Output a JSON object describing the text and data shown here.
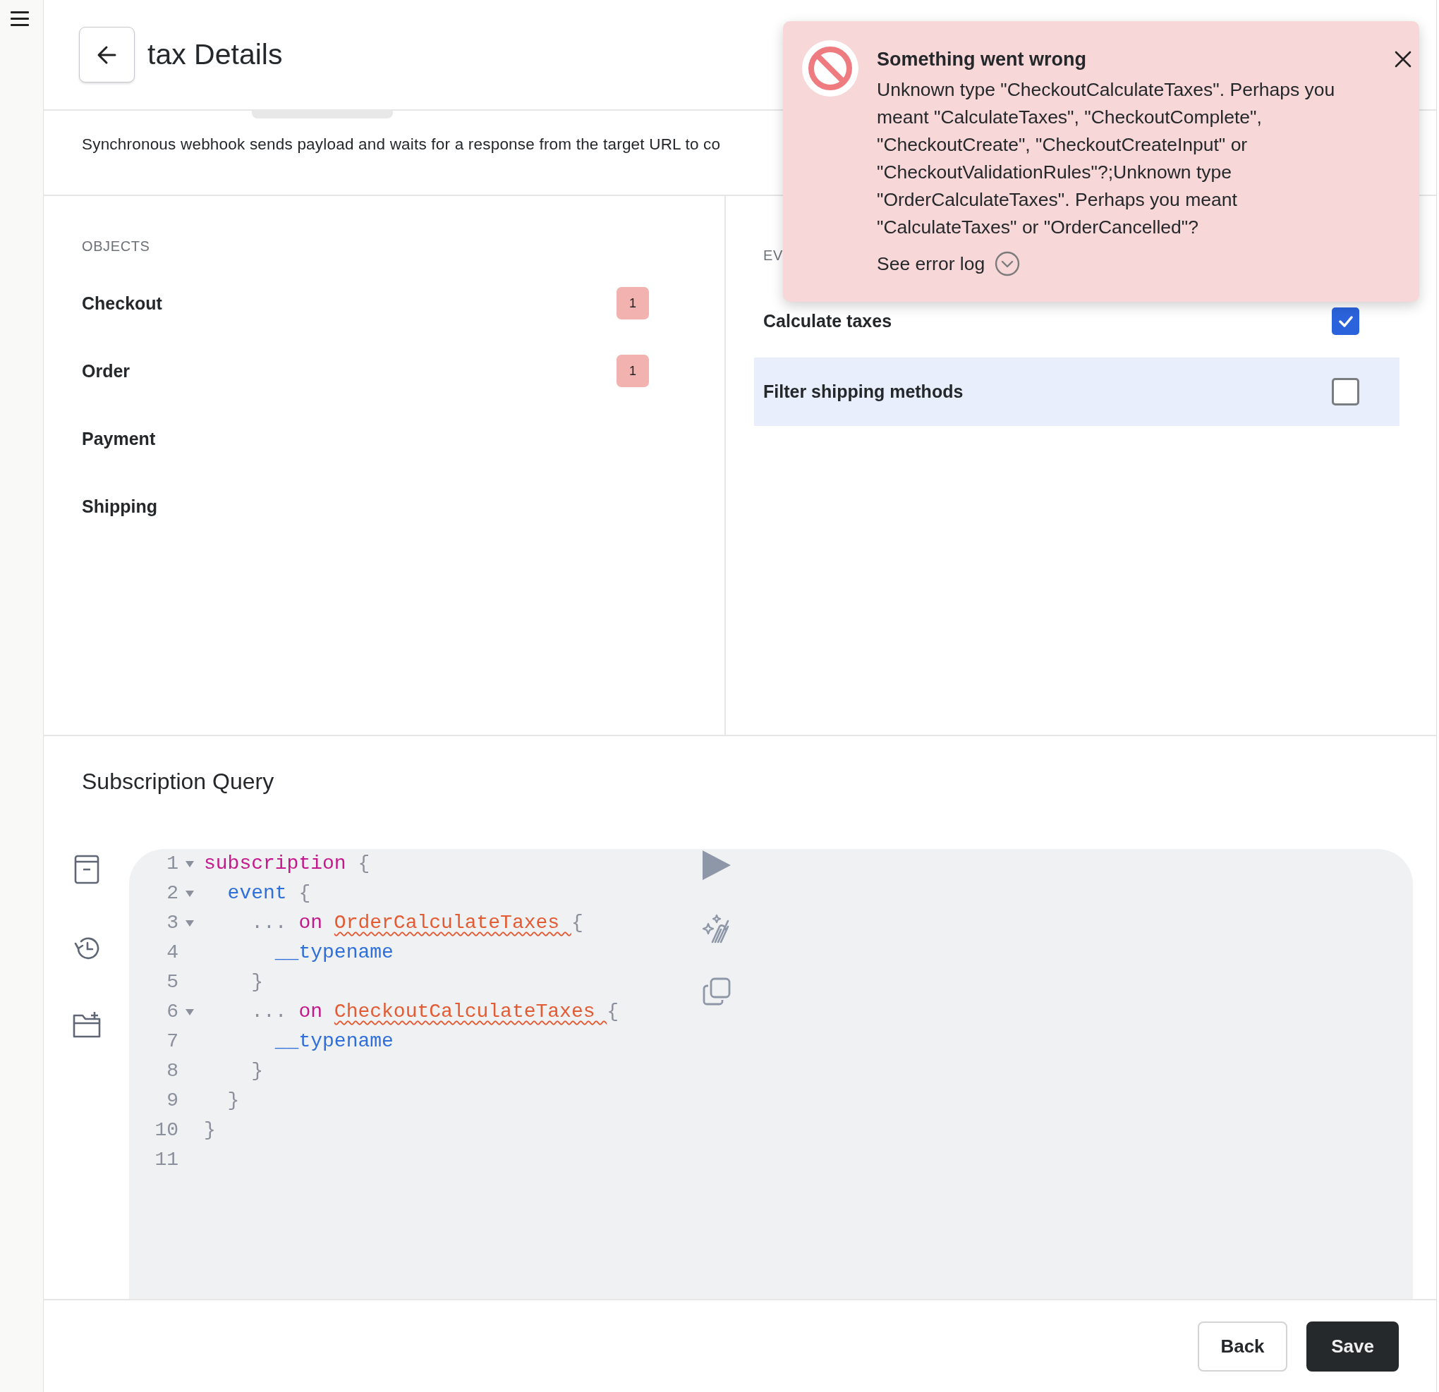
{
  "header": {
    "title": "tax Details"
  },
  "description": "Synchronous webhook sends payload and waits for a response from the target URL to co",
  "objects": {
    "heading": "OBJECTS",
    "items": [
      {
        "name": "Checkout",
        "badge": "1"
      },
      {
        "name": "Order",
        "badge": "1"
      },
      {
        "name": "Payment"
      },
      {
        "name": "Shipping"
      }
    ]
  },
  "events": {
    "heading": "EV",
    "items": [
      {
        "name": "Calculate taxes",
        "checked": true,
        "selected": false
      },
      {
        "name": "Filter shipping methods",
        "checked": false,
        "selected": true
      }
    ]
  },
  "query": {
    "title": "Subscription Query",
    "lines": [
      {
        "number": "1",
        "foldable": true,
        "tokens": [
          {
            "text": "subscription",
            "kind": "keyword"
          },
          {
            "text": " {",
            "kind": "punct"
          }
        ]
      },
      {
        "number": "2",
        "foldable": true,
        "tokens": [
          {
            "text": "  event",
            "kind": "field"
          },
          {
            "text": " {",
            "kind": "punct"
          }
        ]
      },
      {
        "number": "3",
        "foldable": true,
        "tokens": [
          {
            "text": "    ... ",
            "kind": "punct"
          },
          {
            "text": "on ",
            "kind": "keyword"
          },
          {
            "text": "OrderCalculateTaxes ",
            "kind": "error"
          },
          {
            "text": "{",
            "kind": "punct"
          }
        ]
      },
      {
        "number": "4",
        "foldable": false,
        "tokens": [
          {
            "text": "      __typename",
            "kind": "field"
          }
        ]
      },
      {
        "number": "5",
        "foldable": false,
        "tokens": [
          {
            "text": "    }",
            "kind": "punct"
          }
        ]
      },
      {
        "number": "6",
        "foldable": true,
        "tokens": [
          {
            "text": "    ... ",
            "kind": "punct"
          },
          {
            "text": "on ",
            "kind": "keyword"
          },
          {
            "text": "CheckoutCalculateTaxes ",
            "kind": "error"
          },
          {
            "text": "{",
            "kind": "punct"
          }
        ]
      },
      {
        "number": "7",
        "foldable": false,
        "tokens": [
          {
            "text": "      __typename",
            "kind": "field"
          }
        ]
      },
      {
        "number": "8",
        "foldable": false,
        "tokens": [
          {
            "text": "    }",
            "kind": "punct"
          }
        ]
      },
      {
        "number": "9",
        "foldable": false,
        "tokens": [
          {
            "text": "  }",
            "kind": "punct"
          }
        ]
      },
      {
        "number": "10",
        "foldable": false,
        "tokens": [
          {
            "text": "}",
            "kind": "punct"
          }
        ]
      },
      {
        "number": "11",
        "foldable": false
      }
    ]
  },
  "footer": {
    "buttons": [
      {
        "label": "Back",
        "kind": "secondary"
      },
      {
        "label": "Save",
        "kind": "primary"
      }
    ]
  },
  "toast": {
    "title": "Something went wrong",
    "message": "Unknown type \"CheckoutCalculateTaxes\". Perhaps you meant \"CalculateTaxes\", \"CheckoutComplete\", \"CheckoutCreate\", \"CheckoutCreateInput\" or \"CheckoutValidationRules\"?;Unknown type \"OrderCalculateTaxes\". Perhaps you meant \"CalculateTaxes\" or \"OrderCancelled\"?",
    "link": "See error log"
  }
}
